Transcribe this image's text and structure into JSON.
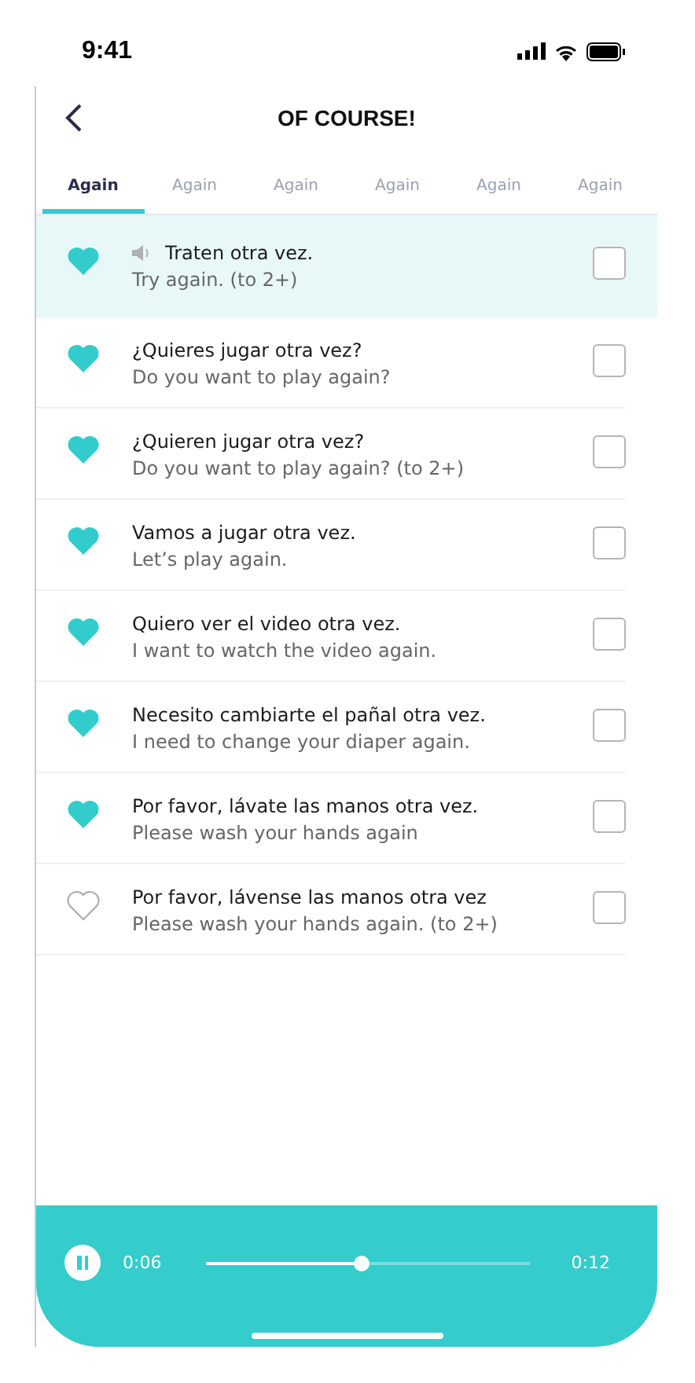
{
  "status_bar": {
    "time": "9:41"
  },
  "header": {
    "title": "OF COURSE!"
  },
  "tabs": [
    {
      "label": "Again",
      "selected": true
    },
    {
      "label": "Again",
      "selected": false
    },
    {
      "label": "Again",
      "selected": false
    },
    {
      "label": "Again",
      "selected": false
    },
    {
      "label": "Again",
      "selected": false
    },
    {
      "label": "Again",
      "selected": false
    }
  ],
  "phrases": [
    {
      "spanish": "Traten otra vez.",
      "english": "Try again. (to 2+)",
      "favorite": true,
      "checked": false,
      "playing": true
    },
    {
      "spanish": "¿Quieres jugar otra vez?",
      "english": "Do you want to play again?",
      "favorite": true,
      "checked": false,
      "playing": false
    },
    {
      "spanish": "¿Quieren jugar otra vez?",
      "english": "Do you want to play again? (to 2+)",
      "favorite": true,
      "checked": false,
      "playing": false
    },
    {
      "spanish": "Vamos a jugar otra vez.",
      "english": "Let’s play again.",
      "favorite": true,
      "checked": false,
      "playing": false
    },
    {
      "spanish": "Quiero ver el video otra vez.",
      "english": "I want to watch the video again.",
      "favorite": true,
      "checked": false,
      "playing": false
    },
    {
      "spanish": "Necesito cambiarte el pañal otra vez.",
      "english": "I need to change your diaper again.",
      "favorite": true,
      "checked": false,
      "playing": false
    },
    {
      "spanish": "Por favor, lávate las manos otra vez.",
      "english": "Please wash your hands again",
      "favorite": true,
      "checked": false,
      "playing": false
    },
    {
      "spanish": "Por favor, lávense las manos otra vez",
      "english": "Please wash your hands again. (to 2+)",
      "favorite": false,
      "checked": false,
      "playing": false
    }
  ],
  "player": {
    "playing": true,
    "elapsed": "0:06",
    "duration": "0:12",
    "level": 0.48
  }
}
